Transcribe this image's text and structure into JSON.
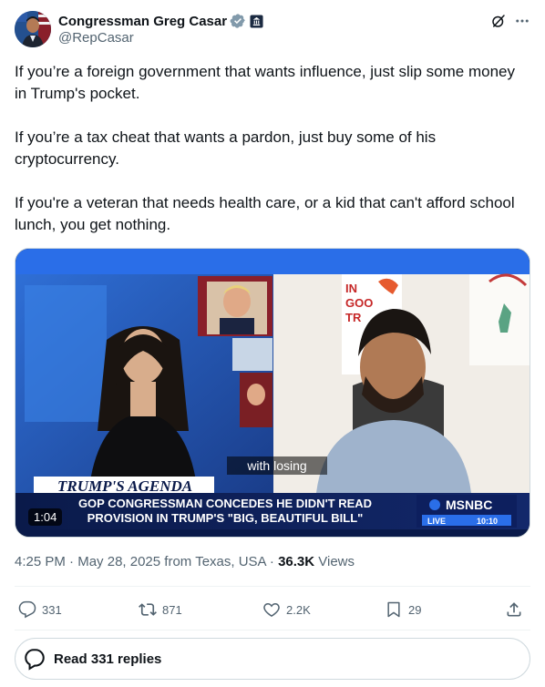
{
  "author": {
    "display_name": "Congressman Greg Casar",
    "handle": "@RepCasar",
    "verified_icon": "verified-badge-icon",
    "affiliation_icon": "government-badge-icon"
  },
  "header_icons": [
    "grok-icon",
    "more-icon"
  ],
  "tweet": {
    "paragraphs": [
      "If you’re a foreign government that wants influence, just slip some money in Trump's pocket.",
      "If you’re a tax cheat that wants a pardon, just buy some of his cryptocurrency.",
      "If you're a veteran that needs health care, or a kid that can't afford school lunch, you get nothing."
    ]
  },
  "video": {
    "duration": "1:04",
    "caption": "with losing",
    "segment_title": "TRUMP'S AGENDA",
    "headline_line1": "GOP CONGRESSMAN CONCEDES HE DIDN'T READ",
    "headline_line2": "PROVISION IN TRUMP'S \"BIG, BEAUTIFUL BILL\"",
    "network": "MSNBC",
    "live_label": "LIVE",
    "live_time": "10:10"
  },
  "meta": {
    "time": "4:25 PM",
    "sep1": " · ",
    "date": "May 28, 2025",
    "location": " from Texas, USA",
    "sep2": " · ",
    "views_count": "36.3K",
    "views_label": " Views"
  },
  "actions": {
    "replies": "331",
    "reposts": "871",
    "likes": "2.2K",
    "bookmarks": "29"
  },
  "read_replies_label": "Read 331 replies",
  "colors": {
    "accent": "#1d9bf0",
    "text": "#0f1419",
    "secondary": "#536471",
    "border": "#cfd9de"
  }
}
